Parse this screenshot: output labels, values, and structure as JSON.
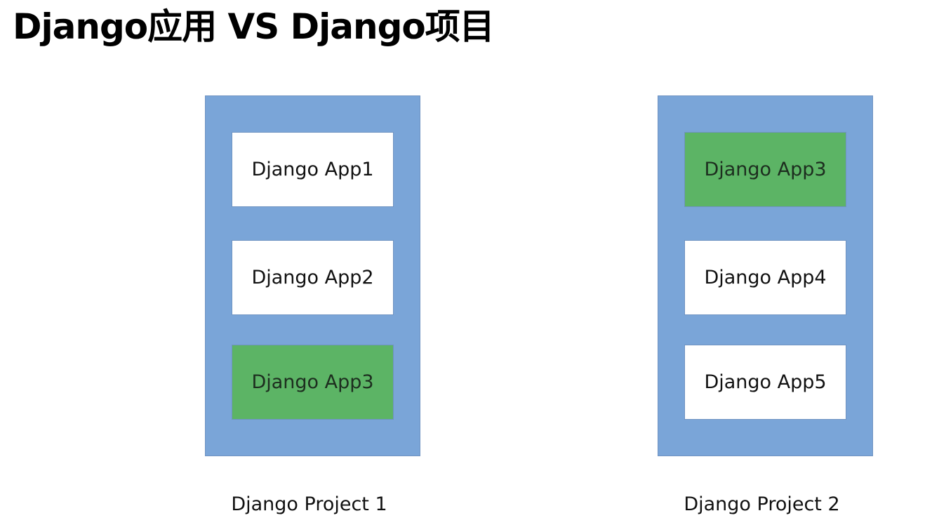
{
  "title": "Django应用 VS Django项目",
  "colors": {
    "project_fill": "#7aa5d8",
    "app_fill": "#ffffff",
    "shared_app_fill": "#5cb465"
  },
  "projects": [
    {
      "caption": "Django Project 1",
      "apps": [
        {
          "label": "Django App1",
          "shared": false
        },
        {
          "label": "Django App2",
          "shared": false
        },
        {
          "label": "Django App3",
          "shared": true
        }
      ]
    },
    {
      "caption": "Django Project 2",
      "apps": [
        {
          "label": "Django App3",
          "shared": true
        },
        {
          "label": "Django App4",
          "shared": false
        },
        {
          "label": "Django App5",
          "shared": false
        }
      ]
    }
  ]
}
